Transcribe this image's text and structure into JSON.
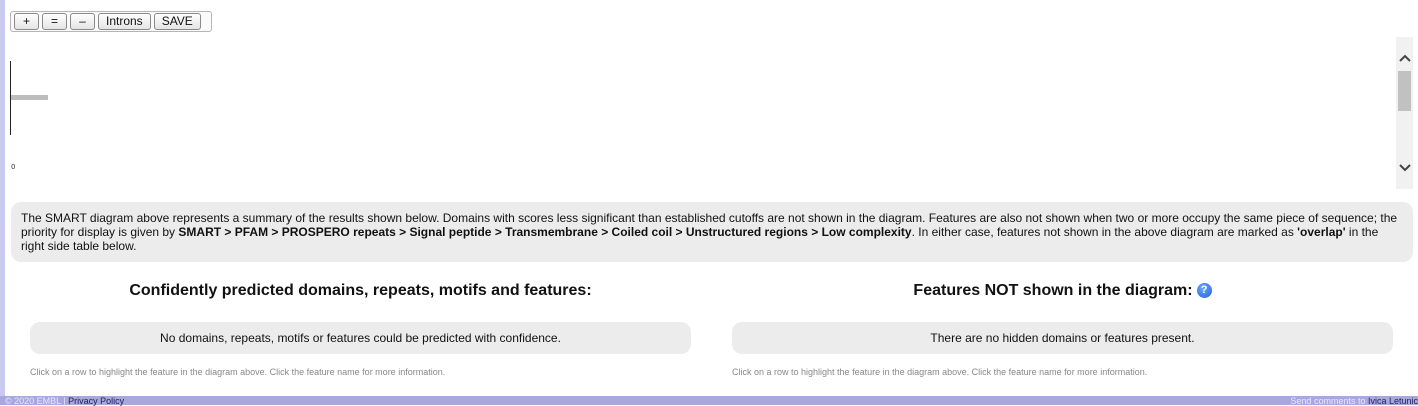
{
  "toolbar": {
    "zoom_in_label": "+",
    "reset_label": "=",
    "zoom_out_label": "–",
    "introns_label": "Introns",
    "save_label": "SAVE"
  },
  "diagram": {
    "tick_label": "0",
    "scroll_up_icon": "chevron-up-icon",
    "scroll_down_icon": "chevron-down-icon"
  },
  "summary": {
    "text_1": "The SMART diagram above represents a summary of the results shown below. Domains with scores less significant than established cutoffs are not shown in the diagram. Features are also not shown when two or more occupy the same piece of sequence; the priority for display is given by ",
    "priority_order": "SMART > PFAM > PROSPERO repeats > Signal peptide > Transmembrane > Coiled coil > Unstructured regions > Low complexity",
    "text_2": ". In either case, features not shown in the above diagram are marked as ",
    "overlap_term": "'overlap'",
    "text_3": " in the right side table below."
  },
  "left_panel": {
    "title": "Confidently predicted domains, repeats, motifs and features:",
    "message": "No domains, repeats, motifs or features could be predicted with confidence.",
    "hint": "Click on a row to highlight the feature in the diagram above. Click the feature name for more information."
  },
  "right_panel": {
    "title": "Features NOT shown in the diagram:",
    "help_icon_glyph": "?",
    "message": "There are no hidden domains or features present.",
    "hint": "Click on a row to highlight the feature in the diagram above. Click the feature name for more information."
  },
  "footer": {
    "copyright": "© 2020 EMBL | ",
    "privacy_link": "Privacy Policy",
    "send_comments": "Send comments to ",
    "contact_link": "Ivica Letunic"
  }
}
